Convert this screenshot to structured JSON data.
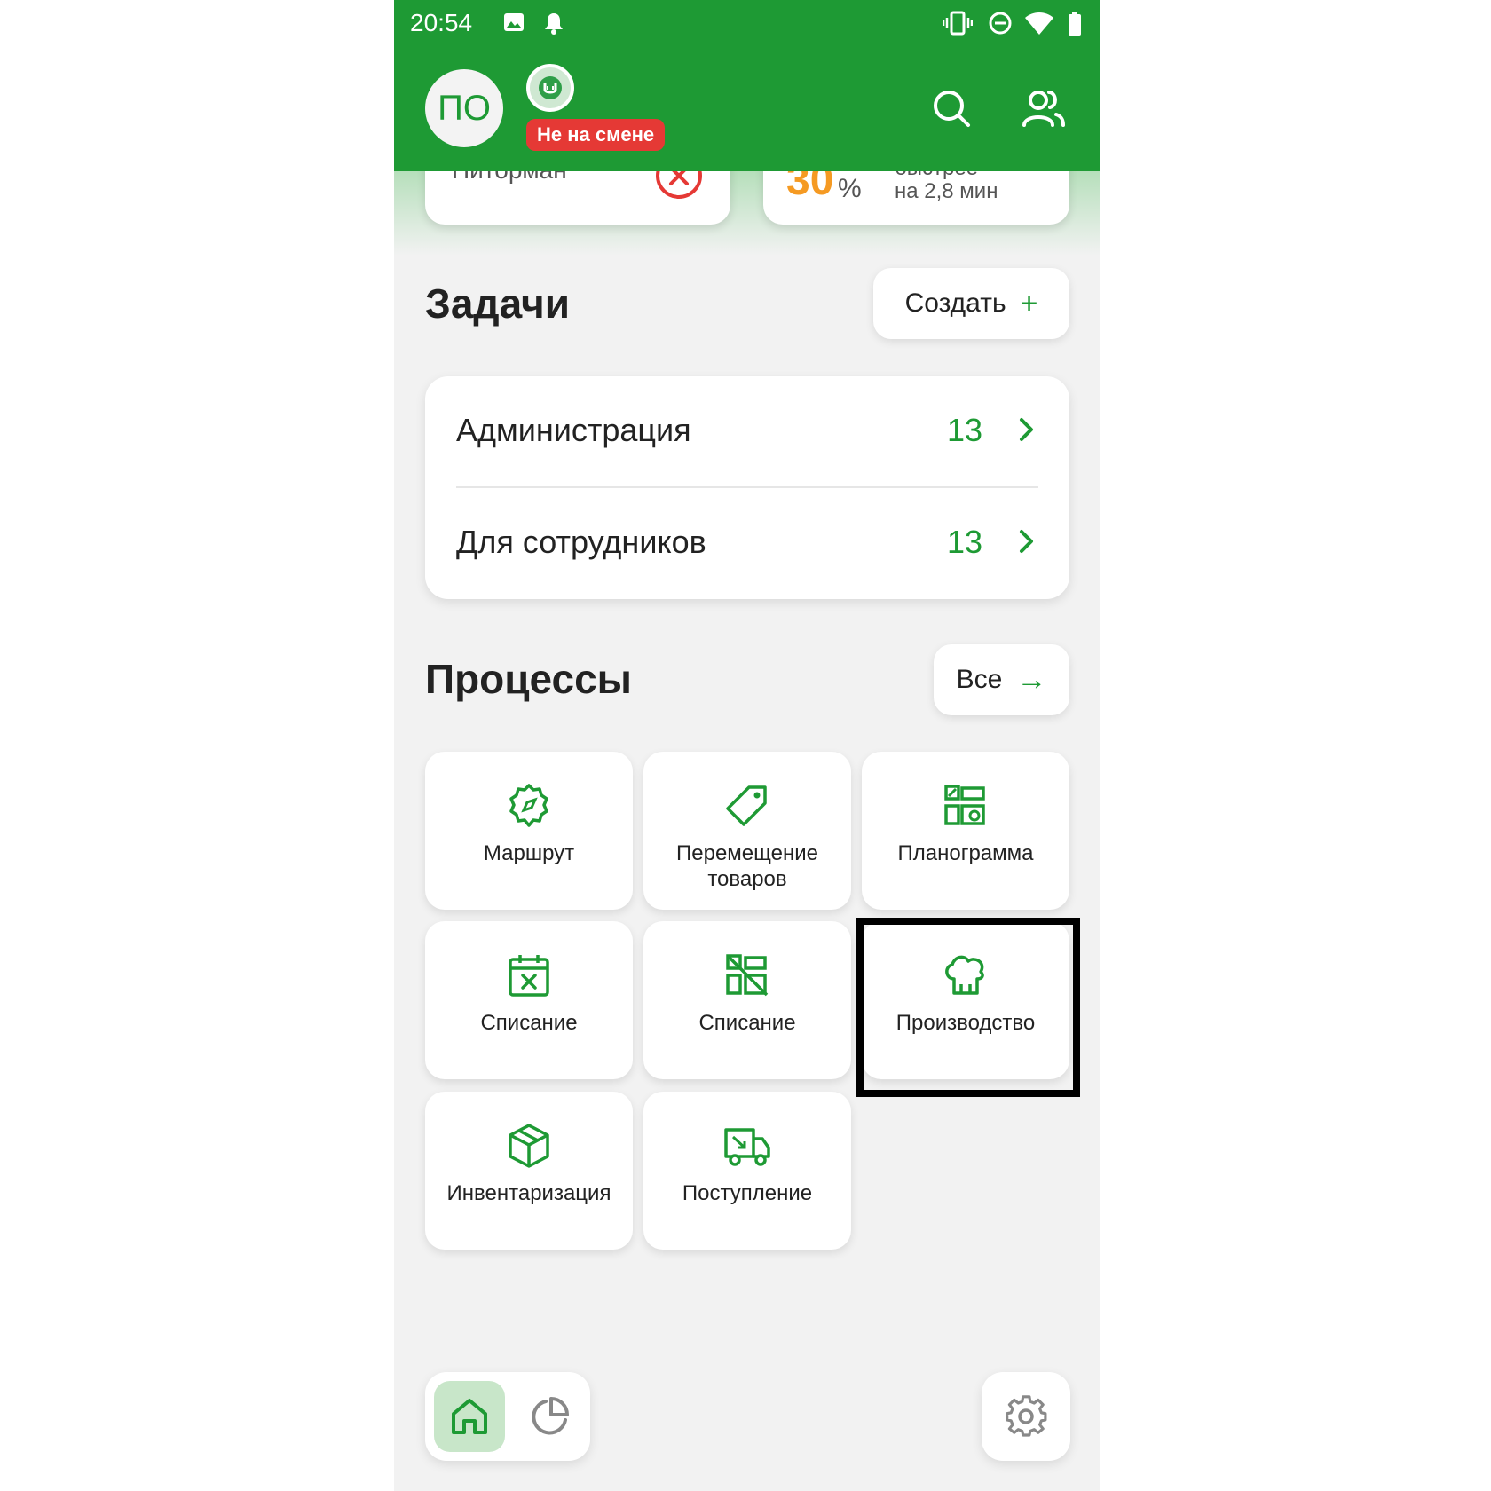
{
  "status_bar": {
    "time": "20:54",
    "icons": [
      "image-icon",
      "alarm-icon",
      "vibrate-icon",
      "do-not-disturb-icon",
      "wifi-icon",
      "battery-icon"
    ]
  },
  "header": {
    "avatar_initials": "ПО",
    "shift_badge": "Не на смене",
    "actions": [
      "search-icon",
      "users-icon"
    ]
  },
  "peek_cards": {
    "left": {
      "name": "Питорман",
      "icon": "close-circle-icon"
    },
    "right": {
      "percent": "30",
      "percent_sign": "%",
      "label_top": "быстрее",
      "label_bottom": "на 2,8 мин"
    }
  },
  "tasks": {
    "title": "Задачи",
    "create_label": "Создать",
    "create_icon": "+",
    "rows": [
      {
        "label": "Администрация",
        "count": "13"
      },
      {
        "label": "Для сотрудников",
        "count": "13"
      }
    ]
  },
  "processes": {
    "title": "Процессы",
    "all_label": "Все",
    "all_icon": "→",
    "tiles": [
      {
        "label": "Маршрут",
        "icon": "route-icon"
      },
      {
        "label": "Перемещение товаров",
        "line1": "Перемещение",
        "line2": "товаров",
        "icon": "tag-icon"
      },
      {
        "label": "Планограмма",
        "icon": "planogram-icon"
      },
      {
        "label": "Списание",
        "icon": "calendar-x-icon"
      },
      {
        "label": "Списание",
        "icon": "writeoff-grid-icon"
      },
      {
        "label": "Производство",
        "icon": "chef-hat-icon",
        "highlighted": true
      },
      {
        "label": "Инвентаризация",
        "icon": "box-icon"
      },
      {
        "label": "Поступление",
        "icon": "truck-icon"
      }
    ]
  },
  "bottom_nav": {
    "items": [
      {
        "icon": "home-icon",
        "active": true
      },
      {
        "icon": "pie-chart-icon",
        "active": false
      }
    ],
    "settings_icon": "gear-icon"
  },
  "colors": {
    "brand_green": "#1e9a34",
    "badge_red": "#e53935",
    "accent_orange": "#f59a23",
    "background": "#f2f2f2"
  }
}
